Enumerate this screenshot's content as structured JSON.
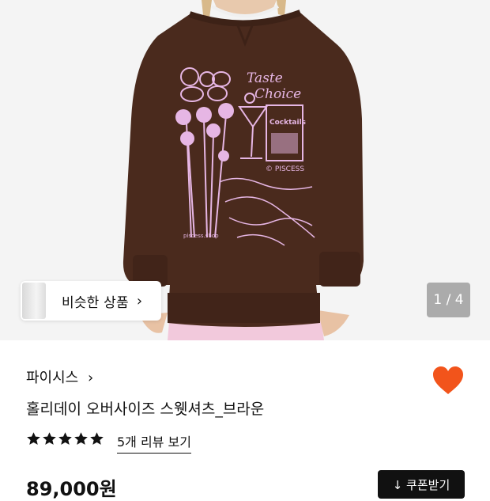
{
  "gallery": {
    "counter_current": "1",
    "counter_total": "4",
    "counter_text": "1 / 4",
    "similar_label": "비슷한 상품",
    "sweatshirt_color": "#4a2a1d",
    "print_color": "#e6b6e4",
    "pants_color": "#f2c9dc"
  },
  "product": {
    "brand": "파이시스",
    "brand_chevron": "›",
    "title": "홀리데이 오버사이즈 스웻셔츠_브라운",
    "rating_stars": 5,
    "review_link": "5개 리뷰 보기",
    "price": "89,000원",
    "coupon_label": "↓ 쿠폰받기",
    "heart_color": "#f2541b"
  }
}
